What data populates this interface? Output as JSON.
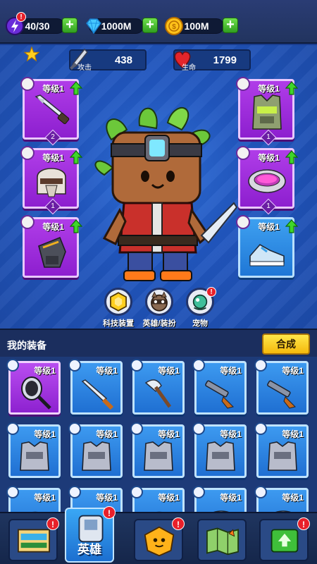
{
  "resources": {
    "energy": "40/30",
    "energy_badge": "!",
    "gems": "1000M",
    "coins": "100M"
  },
  "stats": {
    "attack_label": "攻击",
    "attack_value": "438",
    "hp_label": "生命",
    "hp_value": "1799"
  },
  "slots": {
    "weapon": {
      "level": "等级1",
      "count": "2"
    },
    "armor": {
      "level": "等级1",
      "count": "1"
    },
    "helmet": {
      "level": "等级1",
      "count": "1"
    },
    "ring": {
      "level": "等级1",
      "count": "1"
    },
    "gloves": {
      "level": "等级1"
    },
    "boots": {
      "level": "等级1"
    }
  },
  "quick_buttons": [
    {
      "label": "科技装置"
    },
    {
      "label": "英雄/装扮"
    },
    {
      "label": "宠物",
      "badge": "!"
    }
  ],
  "equipment_panel": {
    "title": "我的装备",
    "merge_label": "合成",
    "items": [
      {
        "level": "等级1",
        "icon": "mirror-icon",
        "rarity": "purple"
      },
      {
        "level": "等级1",
        "icon": "knife-icon",
        "rarity": "blue"
      },
      {
        "level": "等级1",
        "icon": "axe-icon",
        "rarity": "blue"
      },
      {
        "level": "等级1",
        "icon": "shotgun-icon",
        "rarity": "blue"
      },
      {
        "level": "等级1",
        "icon": "shotgun-icon",
        "rarity": "blue"
      },
      {
        "level": "等级1",
        "icon": "vest-icon",
        "rarity": "blue"
      },
      {
        "level": "等级1",
        "icon": "vest-icon",
        "rarity": "blue"
      },
      {
        "level": "等级1",
        "icon": "vest-icon",
        "rarity": "blue"
      },
      {
        "level": "等级1",
        "icon": "vest-icon",
        "rarity": "blue"
      },
      {
        "level": "等级1",
        "icon": "vest-icon",
        "rarity": "blue"
      },
      {
        "level": "等级1",
        "icon": "helmet-icon",
        "rarity": "blue"
      },
      {
        "level": "等级1",
        "icon": "helmet-icon",
        "rarity": "blue"
      },
      {
        "level": "等级1",
        "icon": "helmet-icon",
        "rarity": "blue"
      },
      {
        "level": "等级1",
        "icon": "ring-icon",
        "rarity": "blue"
      },
      {
        "level": "等级1",
        "icon": "ring-icon",
        "rarity": "blue"
      }
    ]
  },
  "bottom_nav": {
    "shop_badge": "!",
    "hero_label": "英雄",
    "hero_badge": "!",
    "talent_badge": "!",
    "map_badge": "",
    "upgrade_badge": "!"
  },
  "colors": {
    "purple_rarity": "#a12fe0",
    "blue_rarity": "#2f86e8",
    "upgrade_arrow": "#3fd62a",
    "alert_red": "#e8202a"
  }
}
